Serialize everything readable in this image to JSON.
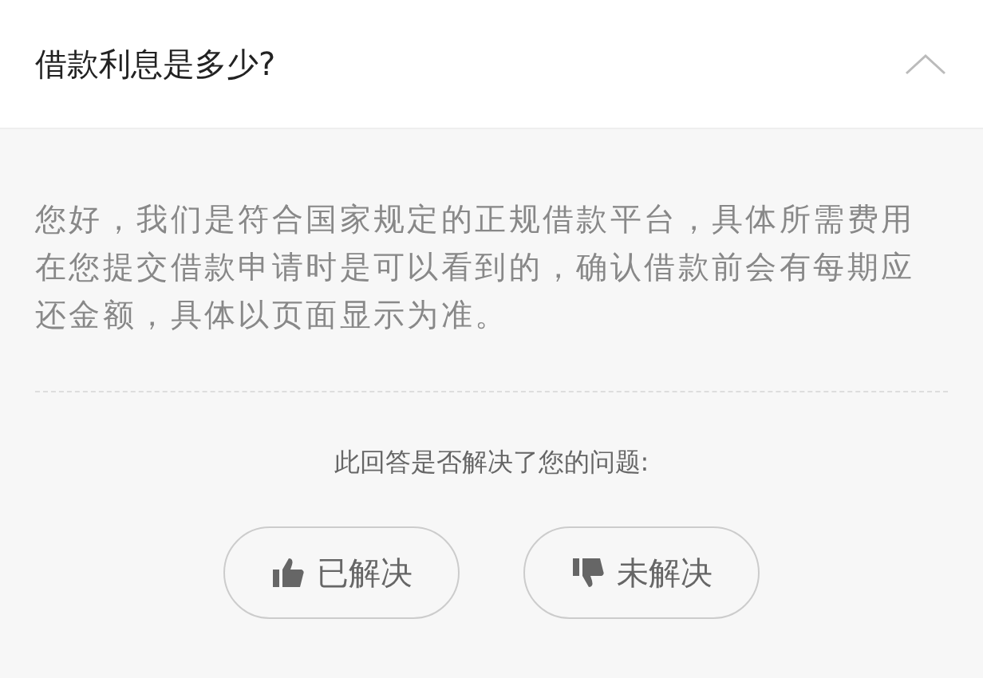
{
  "question": {
    "title": "借款利息是多少?",
    "expanded": true
  },
  "answer": {
    "text": "您好，我们是符合国家规定的正规借款平台，具体所需费用在您提交借款申请时是可以看到的，确认借款前会有每期应还金额，具体以页面显示为准。"
  },
  "feedback": {
    "prompt": "此回答是否解决了您的问题:",
    "buttons": [
      {
        "kind": "thumbs-up",
        "label": "已解决"
      },
      {
        "kind": "thumbs-down",
        "label": "未解决"
      }
    ]
  }
}
